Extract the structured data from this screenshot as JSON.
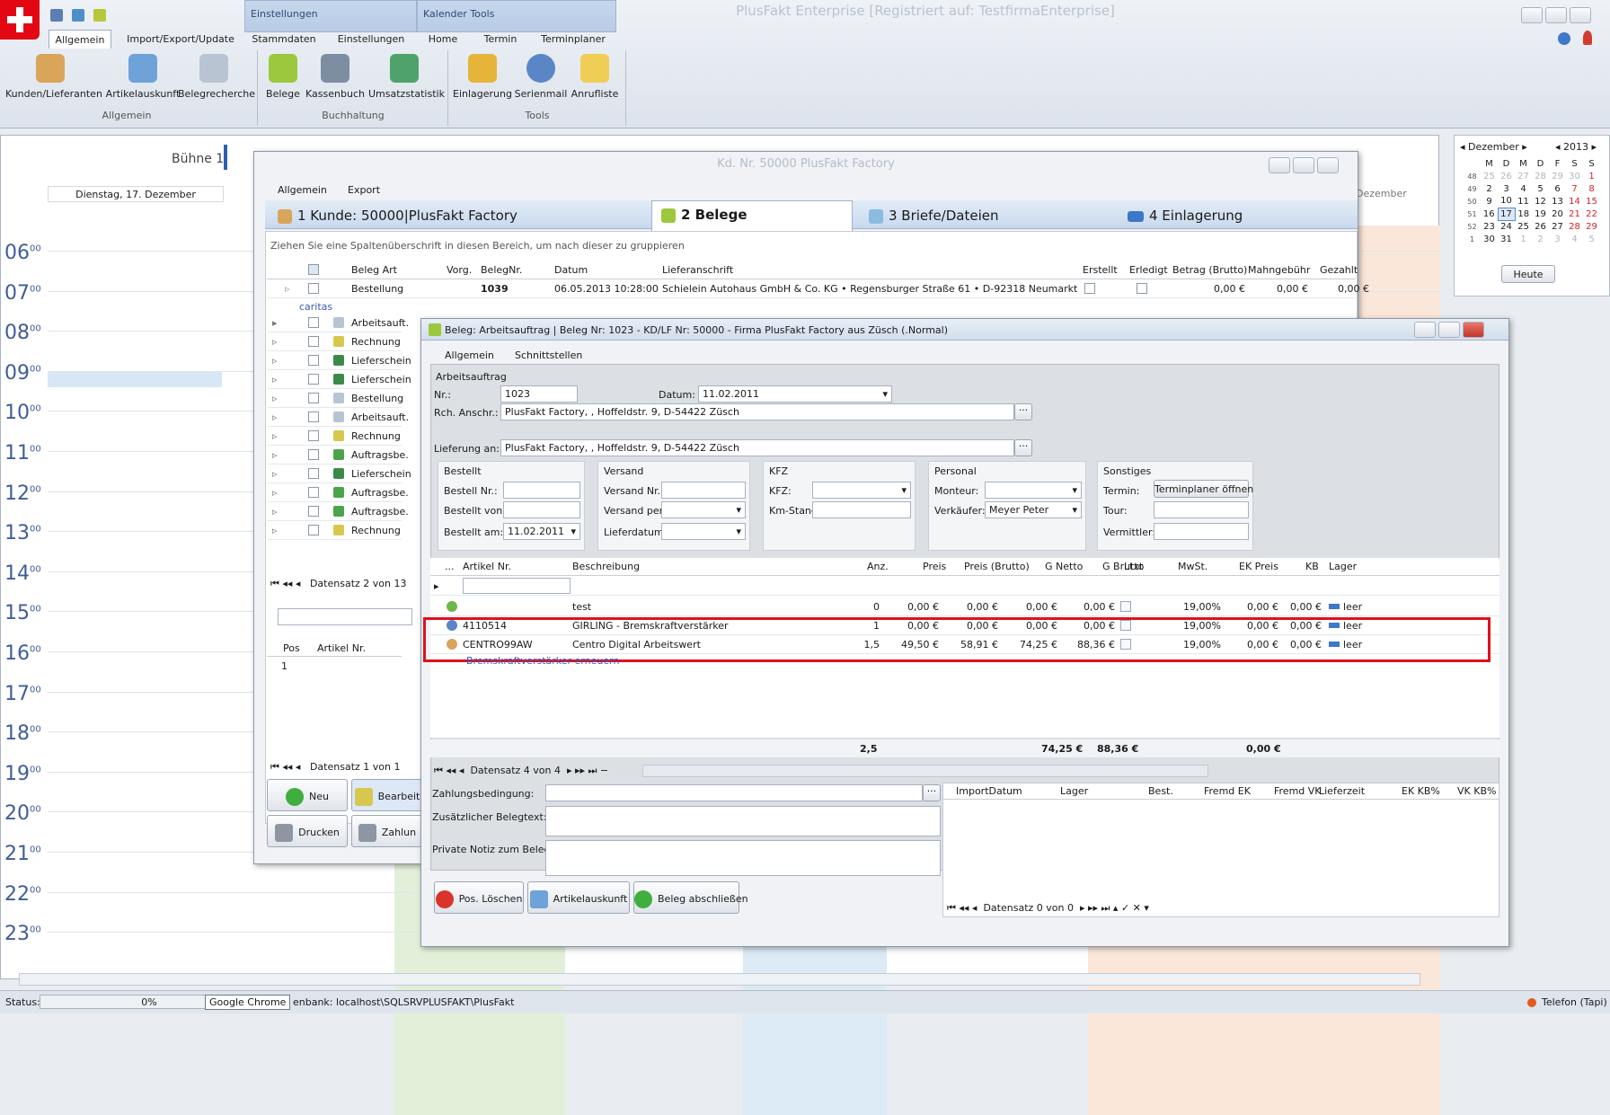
{
  "app": {
    "title": "PlusFakt Enterprise [Registriert auf: TestfirmaEnterprise]",
    "contextTabs": [
      "Einstellungen",
      "Kalender Tools"
    ],
    "tabs": [
      "Allgemein",
      "Import/Export/Update",
      "Stammdaten",
      "Einstellungen",
      "Home",
      "Termin",
      "Terminplaner"
    ],
    "buttons": [
      "Kunden/Lieferanten",
      "Artikelauskunft",
      "Belegrecherche",
      "Belege",
      "Kassenbuch",
      "Umsatzstatistik",
      "Einlagerung",
      "Serienmail",
      "Anrufliste"
    ],
    "groups": [
      "Allgemein",
      "Buchhaltung",
      "Tools"
    ]
  },
  "calendar": {
    "resource": "Bühne 1",
    "day": "Dienstag, 17. Dezember",
    "day2": "Dezember",
    "hours": [
      "06",
      "07",
      "08",
      "09",
      "10",
      "11",
      "12",
      "13",
      "14",
      "15",
      "16",
      "17",
      "18",
      "19",
      "20",
      "21",
      "22",
      "23"
    ],
    "minutes": "00"
  },
  "mini": {
    "month": "Dezember",
    "year": "2013",
    "dow": [
      "M",
      "D",
      "M",
      "D",
      "F",
      "S",
      "S"
    ],
    "weeks": [
      [
        "48",
        "25",
        "26",
        "27",
        "28",
        "29",
        "30",
        "1"
      ],
      [
        "49",
        "2",
        "3",
        "4",
        "5",
        "6",
        "7",
        "8"
      ],
      [
        "50",
        "9",
        "10",
        "11",
        "12",
        "13",
        "14",
        "15"
      ],
      [
        "51",
        "16",
        "17",
        "18",
        "19",
        "20",
        "21",
        "22"
      ],
      [
        "52",
        "23",
        "24",
        "25",
        "26",
        "27",
        "28",
        "29"
      ],
      [
        "1",
        "30",
        "31",
        "1",
        "2",
        "3",
        "4",
        "5"
      ]
    ],
    "today": "Heute"
  },
  "cust": {
    "title": "Kd. Nr. 50000 PlusFakt Factory",
    "menu": [
      "Allgemein",
      "Export"
    ],
    "tabs": [
      "1 Kunde: 50000|PlusFakt Factory",
      "2 Belege",
      "3 Briefe/Dateien",
      "4 Einlagerung"
    ],
    "grouphint": "Ziehen Sie eine Spaltenüberschrift in diesen Bereich, um nach dieser zu gruppieren",
    "cols": [
      "Beleg Art",
      "Vorg.",
      "BelegNr.",
      "Datum",
      "Lieferanschrift",
      "Erstellt",
      "Erledigt",
      "Betrag (Brutto)",
      "Mahngebühr",
      "Gezahlt"
    ],
    "first": {
      "art": "Bestellung",
      "nr": "1039",
      "datum": "06.05.2013 10:28:00",
      "adr": "Schielein Autohaus GmbH & Co. KG • Regensburger Straße 61 • D-92318 Neumarkt",
      "betrag": "0,00 €",
      "mahn": "0,00 €",
      "gez": "0,00 €"
    },
    "sub": "caritas",
    "rows": [
      "Arbeitsauft.",
      "Rechnung",
      "Lieferschein",
      "Lieferschein",
      "Bestellung",
      "Arbeitsauft.",
      "Rechnung",
      "Auftragsbe.",
      "Lieferschein",
      "Auftragsbe.",
      "Auftragsbe.",
      "Rechnung"
    ],
    "nav": "Datensatz 2 von 13",
    "posCols": [
      "Pos",
      "Artikel Nr."
    ],
    "posVal": "1",
    "nav2": "Datensatz 1 von 1",
    "btns": [
      "Neu",
      "Bearbeit",
      "Drucken",
      "Zahlun"
    ]
  },
  "beleg": {
    "title": "Beleg: Arbeitsauftrag | Beleg Nr: 1023 - KD/LF Nr: 50000 - Firma PlusFakt Factory  aus Züsch (.Normal)",
    "menu": [
      "Allgemein",
      "Schnittstellen"
    ],
    "section": "Arbeitsauftrag",
    "nrL": "Nr.:",
    "nr": "1023",
    "datumL": "Datum:",
    "datum": "11.02.2011",
    "rchL": "Rch. Anschr.:",
    "rch": "PlusFakt Factory,  , Hoffeldstr. 9,  D-54422 Züsch",
    "liefL": "Lieferung an:",
    "lief": "PlusFakt Factory,  , Hoffeldstr. 9,  D-54422 Züsch",
    "bestellt": {
      "t": "Bestellt",
      "l1": "Bestell Nr.:",
      "l2": "Bestellt von:",
      "l3": "Bestellt am:",
      "v3": "11.02.2011"
    },
    "versand": {
      "t": "Versand",
      "l1": "Versand Nr.:",
      "l2": "Versand per:",
      "l3": "Lieferdatum:"
    },
    "kfz": {
      "t": "KFZ",
      "l1": "KFZ:",
      "l2": "Km-Stand:"
    },
    "personal": {
      "t": "Personal",
      "l1": "Monteur:",
      "l2": "Verkäufer:",
      "v2": "Meyer Peter"
    },
    "sonst": {
      "t": "Sonstiges",
      "l1": "Termin:",
      "btn": "Terminplaner öffnen",
      "l2": "Tour:",
      "l3": "Vermittler:"
    },
    "cols": [
      "...",
      "Artikel Nr.",
      "Beschreibung",
      "Anz.",
      "Preis",
      "Preis (Brutto)",
      "G Netto",
      "G Brutto",
      "Ltxt",
      "MwSt.",
      "EK Preis",
      "KB",
      "Lager"
    ],
    "items": [
      {
        "nr": "",
        "desc": "test",
        "anz": "0",
        "preis": "0,00 €",
        "pb": "0,00 €",
        "gn": "0,00 €",
        "gb": "0,00 €",
        "mwst": "19,00%",
        "ek": "0,00 €",
        "kb": "0,00 €",
        "lager": "leer"
      },
      {
        "nr": "4110514",
        "desc": "GIRLING - Bremskraftverstärker",
        "anz": "1",
        "preis": "0,00 €",
        "pb": "0,00 €",
        "gn": "0,00 €",
        "gb": "0,00 €",
        "mwst": "19,00%",
        "ek": "0,00 €",
        "kb": "0,00 €",
        "lager": "leer"
      },
      {
        "nr": "CENTRO99AW",
        "desc": "Centro Digital Arbeitswert",
        "anz": "1,5",
        "preis": "49,50 €",
        "pb": "58,91 €",
        "gn": "74,25 €",
        "gb": "88,36 €",
        "mwst": "19,00%",
        "ek": "0,00 €",
        "kb": "0,00 €",
        "lager": "leer"
      }
    ],
    "sublink": "Bremskraftverstärker erneuern",
    "sum": {
      "anz": "2,5",
      "gn": "74,25 €",
      "gb": "88,36 €",
      "ek": "0,00 €"
    },
    "nav": "Datensatz 4 von 4",
    "zahlL": "Zahlungsbedingung:",
    "zusL": "Zusätzlicher Belegtext:",
    "privL": "Private Notiz zum Beleg:",
    "rcols": [
      "ImportDatum",
      "Lager",
      "Best.",
      "Fremd EK",
      "Fremd VK",
      "Lieferzeit",
      "EK KB%",
      "VK KB%"
    ],
    "rnav": "Datensatz 0 von 0",
    "btns": [
      "Pos. Löschen",
      "Artikelauskunft",
      "Beleg abschließen"
    ]
  },
  "status": {
    "label": "Status:",
    "pct": "0%",
    "tooltip": "Google Chrome",
    "db": "enbank: localhost\\SQLSRVPLUSFAKT\\PlusFakt",
    "phone": "Telefon (Tapi)"
  },
  "colors": {
    "highlight": "#e0101c",
    "hour": "#3f5d9a",
    "link": "#3b5bb5"
  }
}
